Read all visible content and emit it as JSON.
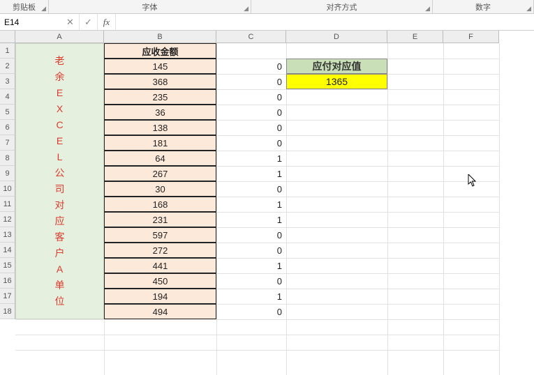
{
  "ribbon": {
    "clipboard": "剪贴板",
    "font": "字体",
    "alignment": "对齐方式",
    "number": "数字"
  },
  "name_box": {
    "value": "E14"
  },
  "formula_bar": {
    "value": ""
  },
  "columns": [
    "A",
    "B",
    "C",
    "D",
    "E"
  ],
  "column_widths": {
    "A": 127,
    "B": 161,
    "C": 100,
    "D": 145,
    "E": 80,
    "F": 80
  },
  "rows": [
    "1",
    "2",
    "3",
    "4",
    "5",
    "6",
    "7",
    "8",
    "9",
    "10",
    "11",
    "12",
    "13",
    "14",
    "15",
    "16",
    "17",
    "18"
  ],
  "colA_chars": [
    "老",
    "余",
    "E",
    "X",
    "C",
    "E",
    "L",
    "公",
    "司",
    "对",
    "应",
    "客",
    "户",
    "A",
    "单",
    "位"
  ],
  "colB_header": "应收金额",
  "colB_values": [
    145,
    368,
    235,
    36,
    138,
    181,
    64,
    267,
    30,
    168,
    231,
    597,
    272,
    441,
    450,
    194,
    494
  ],
  "colC_values": [
    0,
    0,
    0,
    0,
    0,
    0,
    1,
    1,
    0,
    1,
    1,
    0,
    0,
    1,
    0,
    1,
    0
  ],
  "colD_header": "应付对应值",
  "colD_value": 1365,
  "chart_data": {
    "type": "table",
    "title": "",
    "columns": [
      "应收金额",
      "C",
      "应付对应值"
    ],
    "data": [
      {
        "应收金额": 145,
        "C": 0
      },
      {
        "应收金额": 368,
        "C": 0
      },
      {
        "应收金额": 235,
        "C": 0
      },
      {
        "应收金额": 36,
        "C": 0
      },
      {
        "应收金额": 138,
        "C": 0
      },
      {
        "应收金额": 181,
        "C": 0
      },
      {
        "应收金额": 64,
        "C": 1
      },
      {
        "应收金额": 267,
        "C": 1
      },
      {
        "应收金额": 30,
        "C": 0
      },
      {
        "应收金额": 168,
        "C": 1
      },
      {
        "应收金额": 231,
        "C": 1
      },
      {
        "应收金额": 597,
        "C": 0
      },
      {
        "应收金额": 272,
        "C": 0
      },
      {
        "应收金额": 441,
        "C": 1
      },
      {
        "应收金额": 450,
        "C": 0
      },
      {
        "应收金额": 194,
        "C": 1
      },
      {
        "应收金额": 494,
        "C": 0
      }
    ],
    "应付对应值": 1365
  }
}
